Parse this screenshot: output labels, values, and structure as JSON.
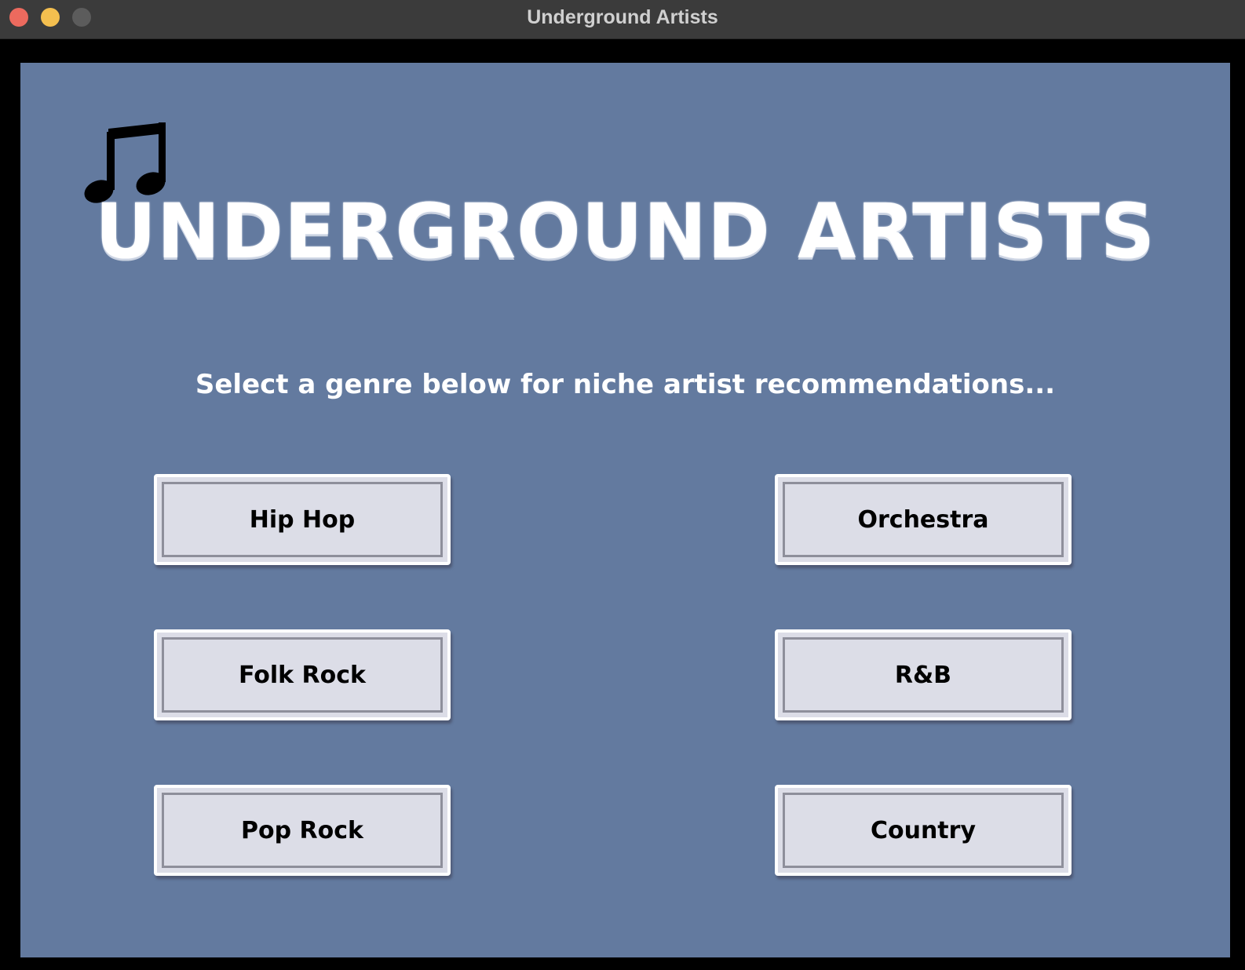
{
  "window": {
    "title": "Underground Artists"
  },
  "main": {
    "title": "UNDERGROUND ARTISTS",
    "subtitle": "Select a genre below for niche artist recommendations...",
    "icon": "music-note-icon"
  },
  "genres": [
    {
      "label": "Hip Hop"
    },
    {
      "label": "Orchestra"
    },
    {
      "label": "Folk Rock"
    },
    {
      "label": "R&B"
    },
    {
      "label": "Pop Rock"
    },
    {
      "label": "Country"
    }
  ],
  "colors": {
    "background": "#637a9f",
    "button": "#dcdde7",
    "title_text": "#ffffff"
  }
}
